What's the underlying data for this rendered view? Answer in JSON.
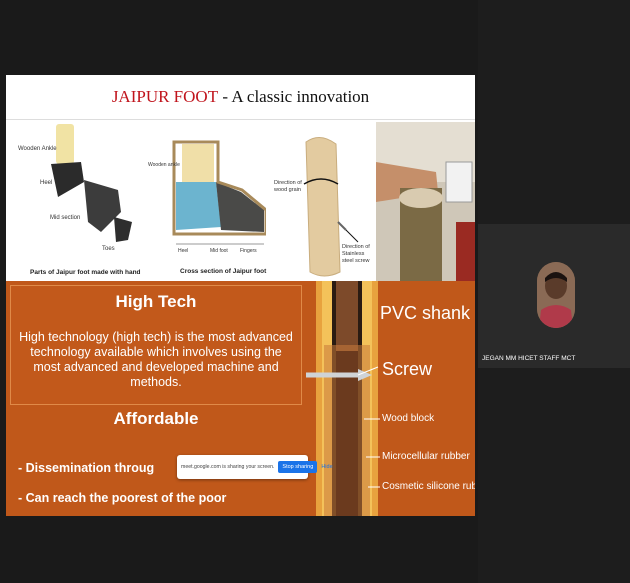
{
  "slide": {
    "title_red": "JAIPUR FOOT",
    "title_black": " - A classic innovation",
    "images": {
      "parts_labels": [
        "Wooden Ankle",
        "Heel",
        "Mid section",
        "Toes"
      ],
      "parts_caption": "Parts of Jaipur foot made with hand",
      "cross_section_labels": [
        "Wooden ankle",
        "Heel",
        "Mid foot",
        "Fingers"
      ],
      "cross_section_caption": "Cross section of Jaipur foot",
      "grain_label": "Direction of wood grain",
      "steel_label": "Direction of Stainless steel screw"
    },
    "high_tech": {
      "heading": "High Tech",
      "body": "High technology (high tech) is the most advanced technology available which involves using the most advanced  and developed machine and methods."
    },
    "affordable": {
      "heading": "Affordable",
      "bullet1": "- Dissemination throug",
      "bullet2": "- Can reach the poorest of the poor"
    },
    "shank_labels": {
      "pvc": "PVC shank",
      "screw": "Screw",
      "wood": "Wood block",
      "micro": "Microcellular rubber",
      "cosmetic": "Cosmetic silicone rubber"
    }
  },
  "share_banner": {
    "message": "meet.google.com is sharing your screen.",
    "stop_label": "Stop sharing",
    "hide_label": "Hide"
  },
  "participant": {
    "name": "JEGAN MM HICET STAFF MCT"
  }
}
